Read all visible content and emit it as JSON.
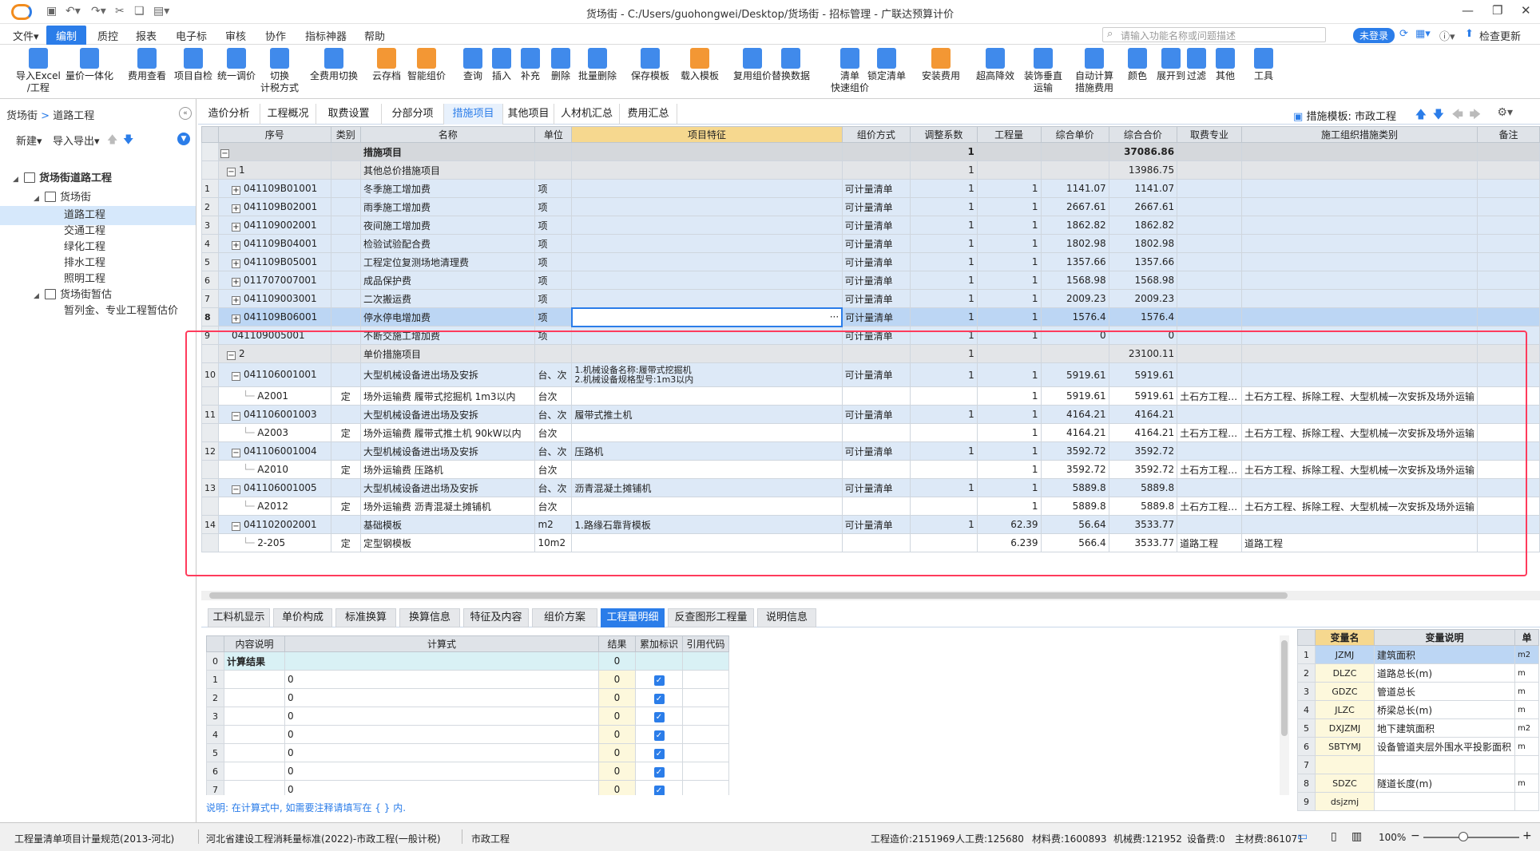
{
  "window": {
    "title": "货场街 - C:/Users/guohongwei/Desktop/货场街 - 招标管理 - 广联达预算计价",
    "minimize": "—",
    "restore": "❐",
    "close": "✕"
  },
  "menubar": {
    "items": [
      "文件▾",
      "编制",
      "质控",
      "报表",
      "电子标",
      "审核",
      "协作",
      "指标神器",
      "帮助"
    ],
    "active_index": 1,
    "search_placeholder": "请输入功能名称或问题描述",
    "login_label": "未登录",
    "update_label": "检查更新"
  },
  "toolbar": {
    "buttons": [
      {
        "label": "导入Excel\n/工程",
        "icon": "import-excel-icon",
        "color": "#2b7de9"
      },
      {
        "label": "量价一体化",
        "icon": "quantity-price-icon",
        "color": "#2b7de9"
      },
      {
        "label": "费用查看",
        "icon": "fee-view-icon",
        "color": "#2b7de9"
      },
      {
        "label": "项目自检",
        "icon": "self-check-icon",
        "color": "#2b7de9"
      },
      {
        "label": "统一调价",
        "icon": "adjust-price-icon",
        "color": "#2b7de9"
      },
      {
        "label": "切换\n计税方式",
        "icon": "tax-switch-icon",
        "color": "#2b7de9"
      },
      {
        "label": "全费用切换",
        "icon": "full-fee-icon",
        "color": "#2b7de9"
      },
      {
        "label": "云存档",
        "icon": "cloud-save-icon",
        "color": "#f28c1e"
      },
      {
        "label": "智能组价",
        "icon": "smart-price-icon",
        "color": "#f28c1e"
      },
      {
        "label": "查询",
        "icon": "query-icon",
        "color": "#2b7de9"
      },
      {
        "label": "插入",
        "icon": "insert-icon",
        "color": "#2b7de9"
      },
      {
        "label": "补充",
        "icon": "supplement-icon",
        "color": "#2b7de9"
      },
      {
        "label": "删除",
        "icon": "delete-icon",
        "color": "#2b7de9"
      },
      {
        "label": "批量删除",
        "icon": "batch-delete-icon",
        "color": "#2b7de9"
      },
      {
        "label": "保存模板",
        "icon": "save-template-icon",
        "color": "#2b7de9"
      },
      {
        "label": "载入模板",
        "icon": "load-template-icon",
        "color": "#f28c1e"
      },
      {
        "label": "复用组价",
        "icon": "reuse-price-icon",
        "color": "#2b7de9"
      },
      {
        "label": "替换数据",
        "icon": "replace-data-icon",
        "color": "#2b7de9"
      },
      {
        "label": "清单\n快速组价",
        "icon": "quick-price-icon",
        "color": "#2b7de9"
      },
      {
        "label": "锁定清单",
        "icon": "lock-icon",
        "color": "#2b7de9"
      },
      {
        "label": "安装费用",
        "icon": "install-fee-icon",
        "color": "#f28c1e"
      },
      {
        "label": "超高降效",
        "icon": "height-icon",
        "color": "#2b7de9"
      },
      {
        "label": "装饰垂直\n运输",
        "icon": "vertical-transport-icon",
        "color": "#2b7de9"
      },
      {
        "label": "自动计算\n措施费用",
        "icon": "auto-calc-icon",
        "color": "#2b7de9"
      },
      {
        "label": "颜色",
        "icon": "color-icon",
        "color": "#2b7de9"
      },
      {
        "label": "展开到",
        "icon": "expand-icon",
        "color": "#2b7de9"
      },
      {
        "label": "过滤",
        "icon": "filter-icon",
        "color": "#2b7de9"
      },
      {
        "label": "其他",
        "icon": "other-icon",
        "color": "#2b7de9"
      },
      {
        "label": "工具",
        "icon": "tools-icon",
        "color": "#2b7de9"
      }
    ]
  },
  "leftpanel": {
    "crumb_root": "货场街",
    "crumb_sep": ">",
    "crumb_current": "道路工程",
    "new_label": "新建▾",
    "import_export_label": "导入导出▾",
    "tree": [
      {
        "label": "货场街道路工程",
        "level": 0,
        "bold": true,
        "icon": "building-icon",
        "expand": "◢"
      },
      {
        "label": "货场街",
        "level": 1,
        "icon": "home-icon",
        "expand": "◢"
      },
      {
        "label": "道路工程",
        "level": 2,
        "selected": true
      },
      {
        "label": "交通工程",
        "level": 2
      },
      {
        "label": "绿化工程",
        "level": 2
      },
      {
        "label": "排水工程",
        "level": 2
      },
      {
        "label": "照明工程",
        "level": 2
      },
      {
        "label": "货场街暂估",
        "level": 1,
        "icon": "home-icon",
        "expand": "◢"
      },
      {
        "label": "暂列金、专业工程暂估价",
        "level": 2
      }
    ]
  },
  "tabs": {
    "items": [
      "造价分析",
      "工程概况",
      "取费设置",
      "分部分项",
      "措施项目",
      "其他项目",
      "人材机汇总",
      "费用汇总"
    ],
    "active_index": 4,
    "template_label": "措施模板: 市政工程"
  },
  "grid": {
    "columns": [
      "",
      "序号",
      "类别",
      "名称",
      "单位",
      "项目特征",
      "组价方式",
      "调整系数",
      "工程量",
      "综合单价",
      "综合合价",
      "取费专业",
      "施工组织措施类别",
      "备注"
    ],
    "rows": [
      {
        "type": "group",
        "rn": "",
        "pm": "−",
        "code": "",
        "cat": "",
        "name": "措施项目",
        "unit": "",
        "feat": "",
        "method": "",
        "coef": "1",
        "qty": "",
        "price": "",
        "total": "37086.86",
        "spec": "",
        "measure": "",
        "note": ""
      },
      {
        "type": "sub",
        "rn": "",
        "pm": "−",
        "code": "1",
        "cat": "",
        "name": "其他总价措施项目",
        "unit": "",
        "feat": "",
        "method": "",
        "coef": "1",
        "qty": "",
        "price": "",
        "total": "13986.75",
        "spec": "",
        "measure": "",
        "note": ""
      },
      {
        "type": "item",
        "rn": "1",
        "pm": "+",
        "code": "041109B01001",
        "cat": "",
        "name": "冬季施工增加费",
        "unit": "项",
        "feat": "",
        "method": "可计量清单",
        "coef": "1",
        "qty": "1",
        "price": "1141.07",
        "total": "1141.07",
        "spec": "",
        "measure": "",
        "note": ""
      },
      {
        "type": "item",
        "rn": "2",
        "pm": "+",
        "code": "041109B02001",
        "cat": "",
        "name": "雨季施工增加费",
        "unit": "项",
        "feat": "",
        "method": "可计量清单",
        "coef": "1",
        "qty": "1",
        "price": "2667.61",
        "total": "2667.61",
        "spec": "",
        "measure": "",
        "note": ""
      },
      {
        "type": "item",
        "rn": "3",
        "pm": "+",
        "code": "041109002001",
        "cat": "",
        "name": "夜间施工增加费",
        "unit": "项",
        "feat": "",
        "method": "可计量清单",
        "coef": "1",
        "qty": "1",
        "price": "1862.82",
        "total": "1862.82",
        "spec": "",
        "measure": "",
        "note": ""
      },
      {
        "type": "item",
        "rn": "4",
        "pm": "+",
        "code": "041109B04001",
        "cat": "",
        "name": "检验试验配合费",
        "unit": "项",
        "feat": "",
        "method": "可计量清单",
        "coef": "1",
        "qty": "1",
        "price": "1802.98",
        "total": "1802.98",
        "spec": "",
        "measure": "",
        "note": ""
      },
      {
        "type": "item",
        "rn": "5",
        "pm": "+",
        "code": "041109B05001",
        "cat": "",
        "name": "工程定位复测场地清理费",
        "unit": "项",
        "feat": "",
        "method": "可计量清单",
        "coef": "1",
        "qty": "1",
        "price": "1357.66",
        "total": "1357.66",
        "spec": "",
        "measure": "",
        "note": ""
      },
      {
        "type": "item",
        "rn": "6",
        "pm": "+",
        "code": "011707007001",
        "cat": "",
        "name": "成品保护费",
        "unit": "项",
        "feat": "",
        "method": "可计量清单",
        "coef": "1",
        "qty": "1",
        "price": "1568.98",
        "total": "1568.98",
        "spec": "",
        "measure": "",
        "note": ""
      },
      {
        "type": "item",
        "rn": "7",
        "pm": "+",
        "code": "041109003001",
        "cat": "",
        "name": "二次搬运费",
        "unit": "项",
        "feat": "",
        "method": "可计量清单",
        "coef": "1",
        "qty": "1",
        "price": "2009.23",
        "total": "2009.23",
        "spec": "",
        "measure": "",
        "note": ""
      },
      {
        "type": "sel",
        "rn": "8",
        "pm": "+",
        "code": "041109B06001",
        "cat": "",
        "name": "停水停电增加费",
        "unit": "项",
        "feat": "···",
        "method": "可计量清单",
        "coef": "1",
        "qty": "1",
        "price": "1576.4",
        "total": "1576.4",
        "spec": "",
        "measure": "",
        "note": ""
      },
      {
        "type": "item",
        "rn": "9",
        "pm": "",
        "code": "041109005001",
        "cat": "",
        "name": "不断交施工增加费",
        "unit": "项",
        "feat": "",
        "method": "可计量清单",
        "coef": "1",
        "qty": "1",
        "price": "0",
        "total": "0",
        "spec": "",
        "measure": "",
        "note": ""
      },
      {
        "type": "sub",
        "rn": "",
        "pm": "−",
        "code": "2",
        "cat": "",
        "name": "单价措施项目",
        "unit": "",
        "feat": "",
        "method": "",
        "coef": "1",
        "qty": "",
        "price": "",
        "total": "23100.11",
        "spec": "",
        "measure": "",
        "note": ""
      },
      {
        "type": "item",
        "rn": "10",
        "pm": "−",
        "code": "041106001001",
        "cat": "",
        "name": "大型机械设备进出场及安拆",
        "unit": "台、次",
        "feat": "1.机械设备名称:履带式挖掘机\n2.机械设备规格型号:1m3以内",
        "method": "可计量清单",
        "coef": "1",
        "qty": "1",
        "price": "5919.61",
        "total": "5919.61",
        "spec": "",
        "measure": "",
        "note": "",
        "tall": true
      },
      {
        "type": "child",
        "rn": "",
        "pm": "",
        "code": "A2001",
        "cat": "定",
        "name": "场外运输费 履带式挖掘机 1m3以内",
        "unit": "台次",
        "feat": "",
        "method": "",
        "coef": "",
        "qty": "1",
        "price": "5919.61",
        "total": "5919.61",
        "spec": "土石方工程…",
        "measure": "土石方工程、拆除工程、大型机械一次安拆及场外运输",
        "note": ""
      },
      {
        "type": "item",
        "rn": "11",
        "pm": "−",
        "code": "041106001003",
        "cat": "",
        "name": "大型机械设备进出场及安拆",
        "unit": "台、次",
        "feat": "履带式推土机",
        "method": "可计量清单",
        "coef": "1",
        "qty": "1",
        "price": "4164.21",
        "total": "4164.21",
        "spec": "",
        "measure": "",
        "note": ""
      },
      {
        "type": "child",
        "rn": "",
        "pm": "",
        "code": "A2003",
        "cat": "定",
        "name": "场外运输费 履带式推土机 90kW以内",
        "unit": "台次",
        "feat": "",
        "method": "",
        "coef": "",
        "qty": "1",
        "price": "4164.21",
        "total": "4164.21",
        "spec": "土石方工程…",
        "measure": "土石方工程、拆除工程、大型机械一次安拆及场外运输",
        "note": ""
      },
      {
        "type": "item",
        "rn": "12",
        "pm": "−",
        "code": "041106001004",
        "cat": "",
        "name": "大型机械设备进出场及安拆",
        "unit": "台、次",
        "feat": "压路机",
        "method": "可计量清单",
        "coef": "1",
        "qty": "1",
        "price": "3592.72",
        "total": "3592.72",
        "spec": "",
        "measure": "",
        "note": ""
      },
      {
        "type": "child",
        "rn": "",
        "pm": "",
        "code": "A2010",
        "cat": "定",
        "name": "场外运输费 压路机",
        "unit": "台次",
        "feat": "",
        "method": "",
        "coef": "",
        "qty": "1",
        "price": "3592.72",
        "total": "3592.72",
        "spec": "土石方工程…",
        "measure": "土石方工程、拆除工程、大型机械一次安拆及场外运输",
        "note": ""
      },
      {
        "type": "item",
        "rn": "13",
        "pm": "−",
        "code": "041106001005",
        "cat": "",
        "name": "大型机械设备进出场及安拆",
        "unit": "台、次",
        "feat": "沥青混凝土摊铺机",
        "method": "可计量清单",
        "coef": "1",
        "qty": "1",
        "price": "5889.8",
        "total": "5889.8",
        "spec": "",
        "measure": "",
        "note": ""
      },
      {
        "type": "child",
        "rn": "",
        "pm": "",
        "code": "A2012",
        "cat": "定",
        "name": "场外运输费 沥青混凝土摊铺机",
        "unit": "台次",
        "feat": "",
        "method": "",
        "coef": "",
        "qty": "1",
        "price": "5889.8",
        "total": "5889.8",
        "spec": "土石方工程…",
        "measure": "土石方工程、拆除工程、大型机械一次安拆及场外运输",
        "note": ""
      },
      {
        "type": "item",
        "rn": "14",
        "pm": "−",
        "code": "041102002001",
        "cat": "",
        "name": "基础模板",
        "unit": "m2",
        "feat": "1.路缘石靠背模板",
        "method": "可计量清单",
        "coef": "1",
        "qty": "62.39",
        "price": "56.64",
        "total": "3533.77",
        "spec": "",
        "measure": "",
        "note": ""
      },
      {
        "type": "child",
        "rn": "",
        "pm": "",
        "code": "2-205",
        "cat": "定",
        "name": "定型钢模板",
        "unit": "10m2",
        "feat": "",
        "method": "",
        "coef": "",
        "qty": "6.239",
        "price": "566.4",
        "total": "3533.77",
        "spec": "道路工程",
        "measure": "道路工程",
        "note": ""
      }
    ]
  },
  "bottom_tabs": {
    "items": [
      "工料机显示",
      "单价构成",
      "标准换算",
      "换算信息",
      "特征及内容",
      "组价方案",
      "工程量明细",
      "反查图形工程量",
      "说明信息"
    ],
    "active_index": 6
  },
  "detail_grid": {
    "columns": [
      "",
      "内容说明",
      "计算式",
      "结果",
      "累加标识",
      "引用代码"
    ],
    "rows": [
      {
        "rn": "0",
        "desc": "计算结果",
        "formula": "",
        "result": "0",
        "check": false
      },
      {
        "rn": "1",
        "desc": "",
        "formula": "0",
        "result": "0",
        "check": true
      },
      {
        "rn": "2",
        "desc": "",
        "formula": "0",
        "result": "0",
        "check": true
      },
      {
        "rn": "3",
        "desc": "",
        "formula": "0",
        "result": "0",
        "check": true
      },
      {
        "rn": "4",
        "desc": "",
        "formula": "0",
        "result": "0",
        "check": true
      },
      {
        "rn": "5",
        "desc": "",
        "formula": "0",
        "result": "0",
        "check": true
      },
      {
        "rn": "6",
        "desc": "",
        "formula": "0",
        "result": "0",
        "check": true
      },
      {
        "rn": "7",
        "desc": "",
        "formula": "0",
        "result": "0",
        "check": true
      }
    ],
    "note": "说明: 在计算式中, 如需要注释请填写在 { } 内."
  },
  "var_grid": {
    "columns": [
      "",
      "变量名",
      "变量说明",
      "单"
    ],
    "rows": [
      {
        "rn": "1",
        "code": "JZMJ",
        "desc": "建筑面积",
        "unit": "m2",
        "sel": true
      },
      {
        "rn": "2",
        "code": "DLZC",
        "desc": "道路总长(m)",
        "unit": "m"
      },
      {
        "rn": "3",
        "code": "GDZC",
        "desc": "管道总长",
        "unit": "m"
      },
      {
        "rn": "4",
        "code": "JLZC",
        "desc": "桥梁总长(m)",
        "unit": "m"
      },
      {
        "rn": "5",
        "code": "DXJZMJ",
        "desc": "地下建筑面积",
        "unit": "m2"
      },
      {
        "rn": "6",
        "code": "SBTYMJ",
        "desc": "设备管道夹层外围水平投影面积",
        "unit": "m"
      },
      {
        "rn": "7",
        "code": "",
        "desc": "",
        "unit": ""
      },
      {
        "rn": "8",
        "code": "SDZC",
        "desc": "隧道长度(m)",
        "unit": "m"
      },
      {
        "rn": "9",
        "code": "dsjzmj",
        "desc": "",
        "unit": ""
      }
    ]
  },
  "status": {
    "spec1": "工程量清单项目计量规范(2013-河北)",
    "spec2": "河北省建设工程消耗量标准(2022)-市政工程(一般计税)",
    "spec3": "市政工程",
    "cost": "工程造价:2151969",
    "labor": "人工费:125680",
    "material": "材料费:1600893",
    "machine": "机械费:121952",
    "equip": "设备费:0",
    "main_mat": "主材费:861071",
    "zoom": "100%"
  }
}
